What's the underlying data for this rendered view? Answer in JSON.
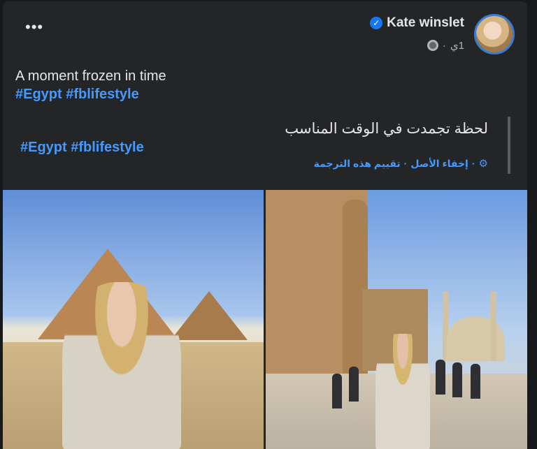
{
  "post": {
    "author": "Kate winslet",
    "time": "1ي",
    "text": "A moment frozen in time",
    "hashtags": [
      "#Egypt",
      "#fblifestyle"
    ],
    "translated_text": "لحظة تجمدت في الوقت المناسب",
    "translated_hashtags": [
      "#Egypt",
      "#fblifestyle"
    ],
    "translation_links": [
      "إخفاء الأصل",
      "تقييم هذه الترجمة"
    ]
  },
  "icons": {
    "more": "more-options-icon",
    "verified": "verified-badge-icon",
    "globe": "globe-icon",
    "gear": "gear-icon"
  },
  "colors": {
    "link": "#4599ff",
    "accent": "#1877f2",
    "card": "#242526"
  }
}
